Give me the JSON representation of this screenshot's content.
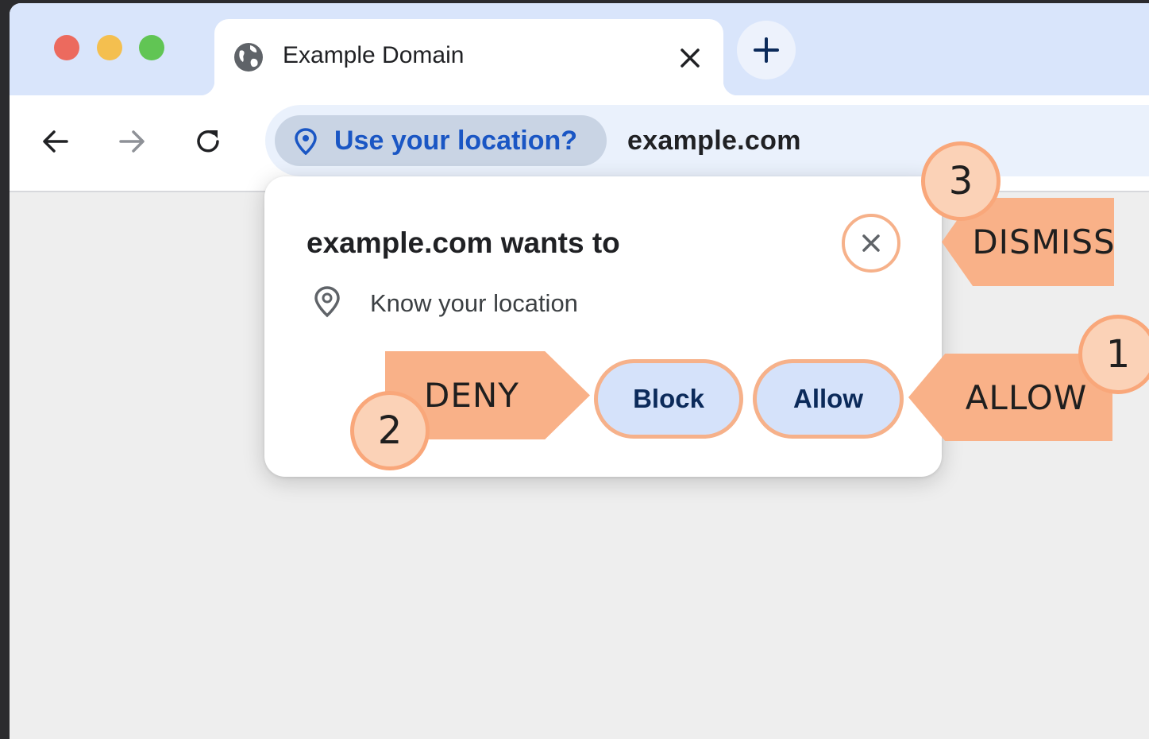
{
  "tab": {
    "title": "Example Domain"
  },
  "omnibox": {
    "chip_label": "Use your location?",
    "url": "example.com"
  },
  "popup": {
    "title": "example.com wants to",
    "permission": "Know your location",
    "block_label": "Block",
    "allow_label": "Allow"
  },
  "annotations": {
    "dismiss": {
      "label": "DISMISS",
      "number": "3"
    },
    "allow": {
      "label": "ALLOW",
      "number": "1"
    },
    "deny": {
      "label": "DENY",
      "number": "2"
    }
  },
  "colors": {
    "tabstrip": "#d9e5fb",
    "chip_bg": "#c9d4e4",
    "chip_text": "#1a56c4",
    "button_bg": "#d5e2fa",
    "annotation": "#f9b188"
  },
  "icons": {
    "favicon": "globe-icon",
    "tab_close": "close-icon",
    "new_tab": "plus-icon",
    "back": "arrow-left-icon",
    "forward": "arrow-right-icon",
    "reload": "reload-icon",
    "location": "location-pin-icon"
  }
}
